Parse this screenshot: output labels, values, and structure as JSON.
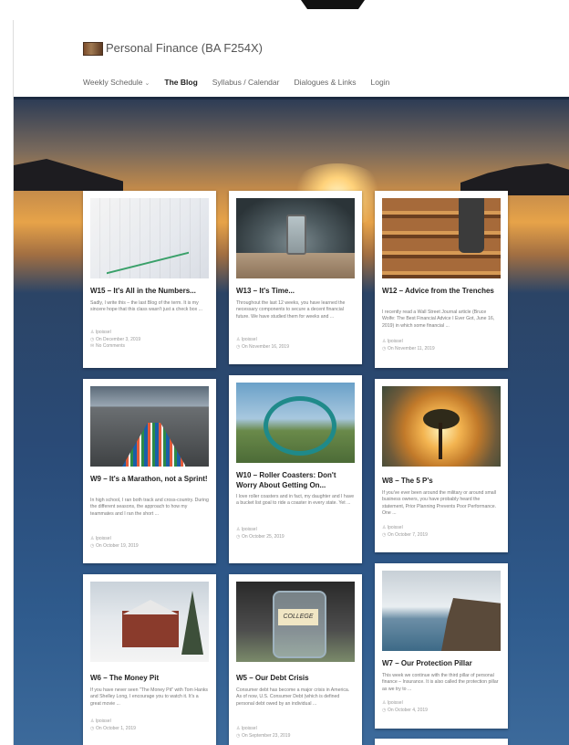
{
  "site": {
    "title": "Personal Finance (BA F254X)"
  },
  "nav": [
    {
      "label": "Weekly Schedule",
      "dropdown": true,
      "active": false
    },
    {
      "label": "The Blog",
      "dropdown": false,
      "active": true
    },
    {
      "label": "Syllabus / Calendar",
      "dropdown": false,
      "active": false
    },
    {
      "label": "Dialogues & Links",
      "dropdown": false,
      "active": false
    },
    {
      "label": "Login",
      "dropdown": false,
      "active": false
    }
  ],
  "posts": [
    {
      "title": "W15 – It's All in the Numbers...",
      "excerpt": "Sadly, I write this – the last Blog of the term. It is my sincere hope that this class wasn't just a check box ...",
      "author": "lpoissel",
      "date": "On December 3, 2019",
      "comments": "No Comments",
      "thumb": "stock-chart-icon"
    },
    {
      "title": "W13 – It's Time...",
      "excerpt": "Throughout the last 12 weeks, you have learned the necessary components to secure a decent financial future. We have studied them for weeks and ...",
      "author": "lpoissel",
      "date": "On November 16, 2019",
      "thumb": "hourglass-icon"
    },
    {
      "title": "W12 – Advice from the Trenches",
      "excerpt": "I recently read a Wall Street Journal article (Bruce Wolfe: The Best Financial Advice I Ever Got, June 16, 2019) in which some financial ...",
      "author": "lpoissel",
      "date": "On November 11, 2019",
      "thumb": "stairs-icon"
    },
    {
      "title": "W9 – It's a Marathon, not a Sprint!",
      "excerpt": "In high school, I ran both track and cross-country. During the different seasons, the approach to how my teammates and I ran the short ...",
      "author": "lpoissel",
      "date": "On October 19, 2019",
      "thumb": "marathon-icon"
    },
    {
      "title": "W10 – Roller Coasters: Don't Worry About Getting On...",
      "excerpt": "I love roller coasters and in fact, my daughter and I have a bucket list goal to ride a coaster in every state. Yet ...",
      "author": "lpoissel",
      "date": "On October 25, 2019",
      "thumb": "roller-coaster-icon"
    },
    {
      "title": "W8 – The 5 P's",
      "excerpt": "If you've ever been around the military or around small business owners, you have probably heard the statement, Prior Planning Prevents Poor Performance. One ...",
      "author": "lpoissel",
      "date": "On October 7, 2019",
      "thumb": "tree-sunset-icon"
    },
    {
      "title": "W6 – The Money Pit",
      "excerpt": "If you have never seen \"The Money Pit\" with Tom Hanks and Shelley Long, I encourage you to watch it. It's a great movie ...",
      "author": "lpoissel",
      "date": "On October 1, 2019",
      "thumb": "house-icon"
    },
    {
      "title": "W5 – Our Debt Crisis",
      "excerpt": "Consumer debt has become a major crisis in America. As of now, U.S. Consumer Debt (which is defined personal debt owed by an individual ...",
      "author": "lpoissel",
      "date": "On September 23, 2019",
      "thumb": "college-jar-icon",
      "thumb_text": "COLLEGE"
    },
    {
      "title": "W7 – Our Protection Pillar",
      "excerpt": "This week we continue with the third pillar of personal finance – Insurance. It is also called the protection pillar as we try to ...",
      "author": "lpoissel",
      "date": "On October 4, 2019",
      "thumb": "cliff-jump-icon"
    }
  ]
}
